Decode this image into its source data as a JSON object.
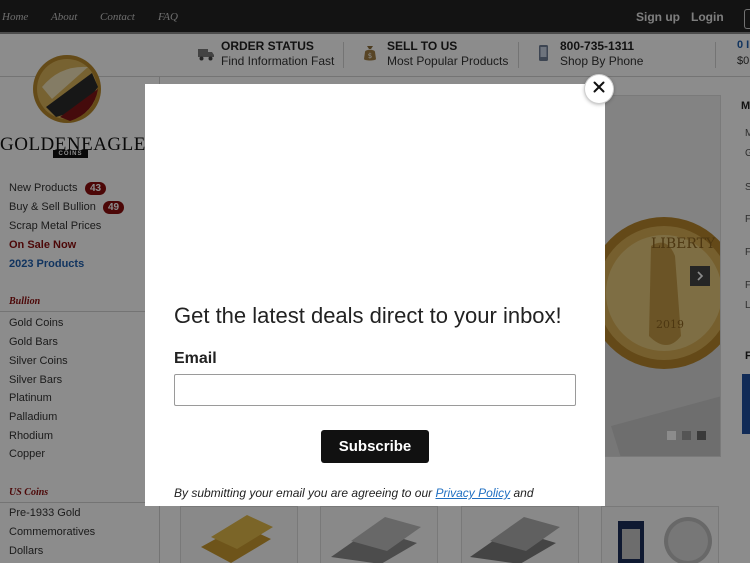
{
  "topnav": {
    "links": [
      "Home",
      "About",
      "Contact",
      "FAQ"
    ],
    "signup": "Sign up",
    "login": "Login"
  },
  "infobar": {
    "order_status": {
      "title": "ORDER STATUS",
      "sub": "Find Information Fast",
      "icon": "truck-icon"
    },
    "sell_to_us": {
      "title": "SELL TO US",
      "sub": "Most Popular Products",
      "icon": "money-bag-icon"
    },
    "phone": {
      "title": "800-735-1311",
      "sub": "Shop By Phone",
      "icon": "phone-icon"
    },
    "cart_count": "0 I",
    "cart_total": "$0"
  },
  "logo": {
    "word": "GOLDENEAGLE",
    "sub": "COINS"
  },
  "sidebar": {
    "top_links": [
      {
        "label": "New Products",
        "badge": "43"
      },
      {
        "label": "Buy & Sell Bullion",
        "badge": "49"
      },
      {
        "label": "Scrap Metal Prices"
      },
      {
        "label": "On Sale Now"
      },
      {
        "label": "2023 Products"
      }
    ],
    "bullion": {
      "heading": "Bullion",
      "items": [
        "Gold Coins",
        "Gold Bars",
        "Silver Coins",
        "Silver Bars",
        "Platinum",
        "Palladium",
        "Rhodium",
        "Copper"
      ]
    },
    "us_coins": {
      "heading": "US Coins",
      "items": [
        "Pre-1933 Gold",
        "Commemoratives",
        "Dollars"
      ]
    }
  },
  "slider": {
    "coin_text": "LIBERTY",
    "coin_year": "2019"
  },
  "right_rail": {
    "letters": [
      "M",
      "M",
      "G",
      "S",
      "F",
      "F",
      "F",
      "L",
      "F"
    ]
  },
  "modal": {
    "heading": "Get the latest deals direct to your inbox!",
    "email_label": "Email",
    "email_value": "",
    "email_placeholder": "",
    "subscribe_label": "Subscribe",
    "legal_prefix": "By submitting your email you are agreeing to our ",
    "privacy_link": "Privacy Policy",
    "legal_suffix": " and",
    "close_icon": "close-icon"
  },
  "colors": {
    "topbar": "#232323",
    "brand_red": "#8b0d0d",
    "link_blue": "#1f5fae",
    "button_black": "#111111",
    "overlay": "rgba(0,0,0,0.45)"
  }
}
